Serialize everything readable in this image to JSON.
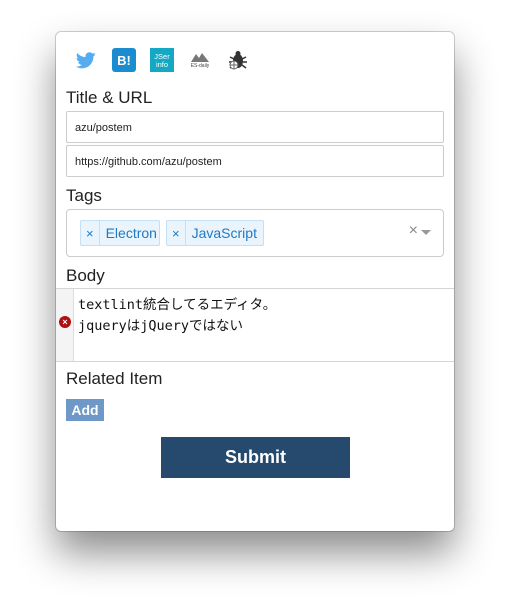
{
  "service_icons": [
    {
      "name": "twitter-icon"
    },
    {
      "name": "hatena-bookmark-icon",
      "text": "B!"
    },
    {
      "name": "jser-info-icon",
      "text_top": "JSer",
      "text_bottom": "info"
    },
    {
      "name": "es-daily-icon",
      "text": "ES-daily"
    },
    {
      "name": "debug-bug-icon"
    }
  ],
  "colors": {
    "twitter": "#55acee",
    "hatena": "#1b8ccf",
    "jser": "#14a8c4",
    "tag_text": "#1f7ac4",
    "add_button": "#6e98c8",
    "submit_button": "#254a6e",
    "error": "#b01010"
  },
  "title_section": {
    "label": "Title & URL",
    "title_value": "azu/postem",
    "url_value": "https://github.com/azu/postem"
  },
  "tags_section": {
    "label": "Tags",
    "tags": [
      {
        "remove": "×",
        "label": "Electron"
      },
      {
        "remove": "×",
        "label": "JavaScript"
      }
    ],
    "clear": "×"
  },
  "body_section": {
    "label": "Body",
    "lines": [
      "textlint統合してるエディタ。",
      "jqueryはjQueryではない"
    ],
    "error_marker": "×"
  },
  "related_section": {
    "label": "Related Item",
    "add_label": "Add"
  },
  "submit_label": "Submit"
}
